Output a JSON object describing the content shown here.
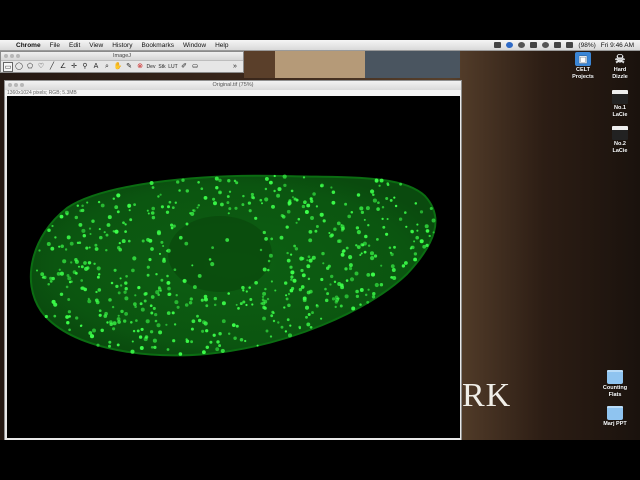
{
  "menubar": {
    "app_name": "Chrome",
    "menus": [
      "File",
      "Edit",
      "View",
      "History",
      "Bookmarks",
      "Window",
      "Help"
    ],
    "battery": "(98%)",
    "clock": "Fri 9:46 AM"
  },
  "imagej": {
    "title": "ImageJ",
    "tools": [
      {
        "icon": "rectangle-selection-icon",
        "glyph": "▭"
      },
      {
        "icon": "oval-selection-icon",
        "glyph": "◯"
      },
      {
        "icon": "polygon-selection-icon",
        "glyph": "⬠"
      },
      {
        "icon": "freehand-selection-icon",
        "glyph": "♡"
      },
      {
        "icon": "straight-line-icon",
        "glyph": "╱"
      },
      {
        "icon": "angle-tool-icon",
        "glyph": "∠"
      },
      {
        "icon": "point-tool-icon",
        "glyph": "✛"
      },
      {
        "icon": "wand-tool-icon",
        "glyph": "⚲"
      },
      {
        "icon": "text-tool-icon",
        "glyph": "A"
      },
      {
        "icon": "magnifying-glass-icon",
        "glyph": "⌕"
      },
      {
        "icon": "hand-tool-icon",
        "glyph": "✋"
      },
      {
        "icon": "dropper-tool-icon",
        "glyph": "✎"
      },
      {
        "icon": "stop-icon",
        "glyph": "⊗"
      },
      {
        "icon": "dev-tool-icon",
        "glyph": "Dev"
      },
      {
        "icon": "stk-tool-icon",
        "glyph": "Stk"
      },
      {
        "icon": "lut-tool-icon",
        "glyph": "LUT"
      },
      {
        "icon": "brush-tool-icon",
        "glyph": "✐"
      },
      {
        "icon": "flood-fill-icon",
        "glyph": "⛀"
      }
    ],
    "more_label": "»"
  },
  "image_window": {
    "title": "Original.tif (75%)",
    "info": "1360x1024 pixels; RGB; 5.3MB"
  },
  "background_text": "RK",
  "desktop_icons": [
    {
      "label_line1": "CELT",
      "label_line2": "Projects",
      "icon": "celt-projects-icon"
    },
    {
      "label_line1": "Hard",
      "label_line2": "Dizzle",
      "icon": "skull-drive-icon"
    },
    {
      "label_line1": "No.1",
      "label_line2": "LaCie",
      "icon": "clapboard-drive-icon"
    },
    {
      "label_line1": "No.2",
      "label_line2": "LaCie",
      "icon": "clapboard-drive-icon"
    },
    {
      "label_line1": "Counting",
      "label_line2": "Flats",
      "icon": "folder-icon"
    },
    {
      "label_line1": "Marj PPT",
      "label_line2": "",
      "icon": "folder-icon"
    }
  ],
  "colors": {
    "cell_fill": "#0c5a10",
    "cell_edge": "#0a7a14",
    "spot": "#3cff4a",
    "nucleus": "#0b4c0d"
  }
}
